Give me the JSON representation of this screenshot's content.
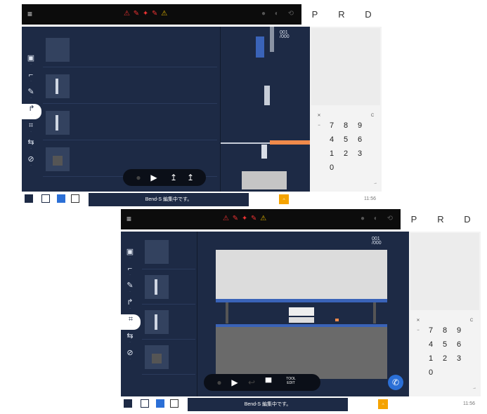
{
  "modes": [
    "P",
    "R",
    "D"
  ],
  "status_message": "Bend-S 編集中です。",
  "time": "11:56",
  "keypad": {
    "rows": [
      [
        "7",
        "8",
        "9"
      ],
      [
        "4",
        "5",
        "6"
      ],
      [
        "1",
        "2",
        "3"
      ],
      [
        "0"
      ]
    ],
    "top_left": "✕",
    "top_right": "C",
    "minus_key": "−",
    "plus_key": "+",
    "enter_key": "→"
  },
  "tool_label": "TOOL\nEDIT",
  "counter": {
    "value": "001",
    "total": "/000"
  },
  "colors": {
    "navy": "#1d2a45",
    "accent_orange": "#f08a4b",
    "blue_button": "#2b6fd6",
    "topbar": "#0c0c0c"
  },
  "icons": [
    "menu-icon",
    "warning-icon",
    "play-icon",
    "bend-icon",
    "phone-icon",
    "gear-icon"
  ]
}
